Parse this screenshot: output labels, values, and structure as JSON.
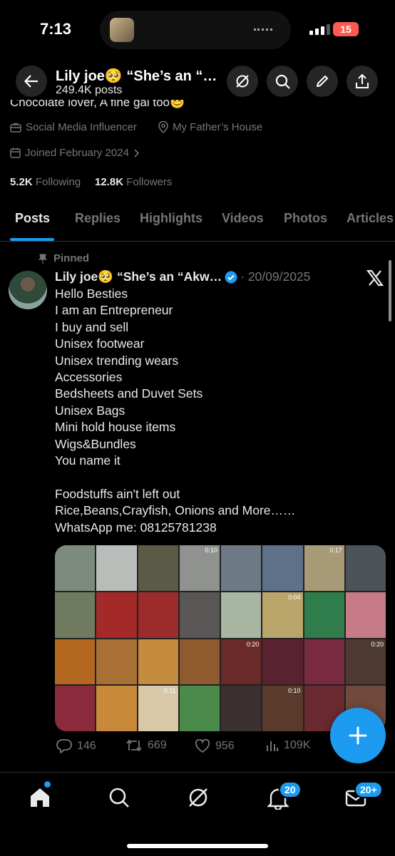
{
  "status_bar": {
    "time": "7:13",
    "battery": "15"
  },
  "header": {
    "name": "Lily joe🥺 “She’s an “…",
    "posts": "249.4K posts"
  },
  "profile": {
    "bio_partial": "Chocolate lover, A fine gal too😊",
    "category": "Social Media Influencer",
    "location": "My Father’s House",
    "joined": "Joined February 2024",
    "following_count": "5.2K",
    "following_label": "Following",
    "followers_count": "12.8K",
    "followers_label": "Followers"
  },
  "tabs": [
    {
      "label": "Posts",
      "active": true
    },
    {
      "label": "Replies"
    },
    {
      "label": "Highlights"
    },
    {
      "label": "Videos"
    },
    {
      "label": "Photos"
    },
    {
      "label": "Articles"
    }
  ],
  "post": {
    "pinned_label": "Pinned",
    "author": "Lily joe🥺 “She’s an “Akw…",
    "date": "· 20/09/2025",
    "body": "Hello Besties\nI am an Entrepreneur\nI buy and sell\nUnisex footwear\nUnisex trending wears\nAccessories\nBedsheets and Duvet Sets\nUnisex Bags\nMini hold house items\nWigs&Bundles\nYou name it\n\nFoodstuffs ain't left out\nRice,Beans,Crayfish, Onions and More……\nWhatsApp me: 08125781238",
    "media_timestamps": [
      "0:10",
      "0:17",
      "0:04",
      "0:20",
      "0:20",
      "0:11",
      "0:10"
    ],
    "replies": "146",
    "reposts": "669",
    "likes": "956",
    "views": "109K"
  },
  "bottom_nav": {
    "notifications_badge": "20",
    "messages_badge": "20+"
  },
  "colors": {
    "accent": "#1d9bf0",
    "background": "#000000",
    "muted": "#71767b"
  }
}
